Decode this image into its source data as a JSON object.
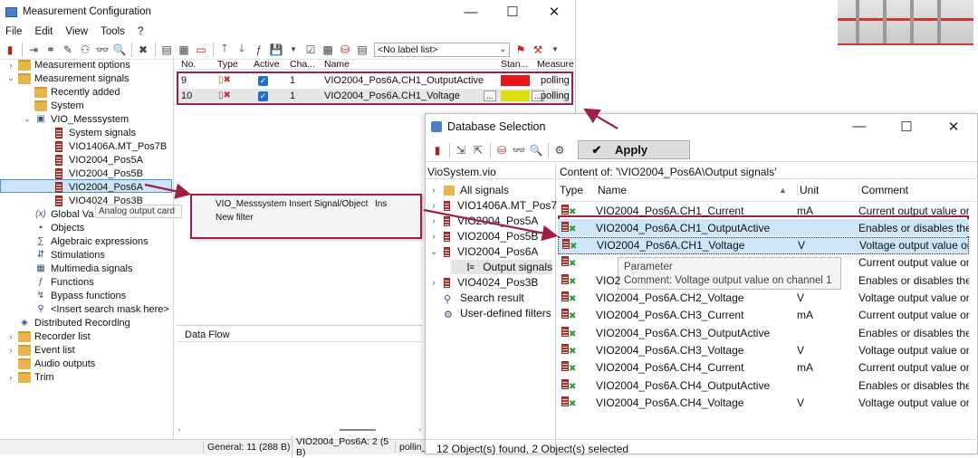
{
  "main": {
    "title": "Measurement Configuration",
    "menu": [
      "File",
      "Edit",
      "View",
      "Tools",
      "?"
    ],
    "label_list": "<No label list>",
    "tree": [
      {
        "label": "Measurement options",
        "icon": "folder-icon",
        "toggle": "›"
      },
      {
        "label": "Measurement signals",
        "icon": "folder-icon",
        "toggle": "⌄"
      },
      {
        "label": "Recently added",
        "icon": "folder-icon",
        "toggle": ""
      },
      {
        "label": "System",
        "icon": "folder-icon",
        "toggle": ""
      },
      {
        "label": "VIO_Messsystem",
        "icon": "device-icon",
        "toggle": "⌄"
      },
      {
        "label": "System signals",
        "icon": "signal-icon",
        "toggle": ""
      },
      {
        "label": "VIO1406A.MT_Pos7B",
        "icon": "signal-icon",
        "toggle": ""
      },
      {
        "label": "VIO2004_Pos5A",
        "icon": "signal-icon",
        "toggle": ""
      },
      {
        "label": "VIO2004_Pos5B",
        "icon": "signal-icon",
        "toggle": ""
      },
      {
        "label": "VIO2004_Pos6A",
        "icon": "signal-icon",
        "toggle": ""
      },
      {
        "label": "VIO4024_Pos3B",
        "icon": "signal-icon",
        "toggle": ""
      },
      {
        "label": "Global Va",
        "icon": "variable-icon",
        "toggle": ""
      },
      {
        "label": "Objects",
        "icon": "objects-icon",
        "toggle": ""
      },
      {
        "label": "Algebraic expressions",
        "icon": "expression-icon",
        "toggle": ""
      },
      {
        "label": "Stimulations",
        "icon": "stimulation-icon",
        "toggle": ""
      },
      {
        "label": "Multimedia signals",
        "icon": "multimedia-icon",
        "toggle": ""
      },
      {
        "label": "Functions",
        "icon": "function-icon",
        "toggle": ""
      },
      {
        "label": "Bypass functions",
        "icon": "bypass-icon",
        "toggle": ""
      },
      {
        "label": "<Insert search mask here>",
        "icon": "search-icon",
        "toggle": ""
      },
      {
        "label": "Distributed Recording",
        "icon": "recording-icon",
        "toggle": ""
      },
      {
        "label": "Recorder list",
        "icon": "folder-icon",
        "toggle": "›"
      },
      {
        "label": "Event list",
        "icon": "folder-icon",
        "toggle": "›"
      },
      {
        "label": "Audio outputs",
        "icon": "folder-icon",
        "toggle": ""
      },
      {
        "label": "Trim",
        "icon": "folder-icon",
        "toggle": "›"
      }
    ],
    "tooltip": "Analog output card",
    "columns": [
      "No.",
      "Type",
      "Active",
      "Cha...",
      "Name",
      "Stan...",
      "Measure"
    ],
    "rows": [
      {
        "no": "9",
        "channel": "1",
        "name": "VIO2004_Pos6A.CH1_OutputActive",
        "standard_color": "#e81616",
        "measure": "polling"
      },
      {
        "no": "10",
        "channel": "1",
        "name": "VIO2004_Pos6A.CH1_Voltage",
        "standard_color": "#dede10",
        "measure": "polling"
      }
    ],
    "ellipsis": "...",
    "context_menu": [
      {
        "label": "VIO_Messsystem Insert Signal/Object",
        "shortcut": "Ins"
      },
      {
        "label": "New filter",
        "shortcut": ""
      }
    ],
    "data_flow_title": "Data Flow",
    "status": {
      "general": "General:  11 (288 B)",
      "device": "VIO2004_Pos6A: 2 (5 B)",
      "mode": "pollin_"
    }
  },
  "db": {
    "title": "Database Selection",
    "apply": "Apply",
    "root": "VioSystem.vio",
    "content_of": "Content of: '\\VIO2004_Pos6A\\Output signals'",
    "tree": [
      {
        "label": "VioSystem.vio",
        "toggle": "",
        "indent": 0
      },
      {
        "label": "All signals",
        "toggle": "›",
        "indent": 1
      },
      {
        "label": "VIO1406A.MT_Pos7",
        "toggle": "›",
        "indent": 1
      },
      {
        "label": "VIO2004_Pos5A",
        "toggle": "›",
        "indent": 1
      },
      {
        "label": "VIO2004_Pos5B",
        "toggle": "›",
        "indent": 1
      },
      {
        "label": "VIO2004_Pos6A",
        "toggle": "⌄",
        "indent": 1
      },
      {
        "label": "Output signals",
        "toggle": "",
        "indent": 2
      },
      {
        "label": "VIO4024_Pos3B",
        "toggle": "›",
        "indent": 1
      },
      {
        "label": "Search result",
        "toggle": "",
        "indent": 0
      },
      {
        "label": "User-defined filters",
        "toggle": "",
        "indent": 0
      }
    ],
    "columns": [
      "Type",
      "Name",
      "Unit",
      "Comment"
    ],
    "rows": [
      {
        "name": "VIO2004_Pos6A.CH1_Current",
        "unit": "mA",
        "comment": "Current output value on"
      },
      {
        "name": "VIO2004_Pos6A.CH1_OutputActive",
        "unit": "",
        "comment": "Enables or disables the v"
      },
      {
        "name": "VIO2004_Pos6A.CH1_Voltage",
        "unit": "V",
        "comment": "Voltage output value on"
      },
      {
        "name": "",
        "unit": "",
        "comment": "Current output value on"
      },
      {
        "name": "VIO2",
        "unit": "",
        "comment": "Enables or disables the v"
      },
      {
        "name": "VIO2004_Pos6A.CH2_Voltage",
        "unit": "V",
        "comment": "Voltage output value on"
      },
      {
        "name": "VIO2004_Pos6A.CH3_Current",
        "unit": "mA",
        "comment": "Current output value on"
      },
      {
        "name": "VIO2004_Pos6A.CH3_OutputActive",
        "unit": "",
        "comment": "Enables or disables the v"
      },
      {
        "name": "VIO2004_Pos6A.CH3_Voltage",
        "unit": "V",
        "comment": "Voltage output value on"
      },
      {
        "name": "VIO2004_Pos6A.CH4_Current",
        "unit": "mA",
        "comment": "Current output value on"
      },
      {
        "name": "VIO2004_Pos6A.CH4_OutputActive",
        "unit": "",
        "comment": "Enables or disables the v"
      },
      {
        "name": "VIO2004_Pos6A.CH4_Voltage",
        "unit": "V",
        "comment": "Voltage output value on"
      }
    ],
    "tooltip_title": "Parameter",
    "tooltip_comment": "Comment: Voltage output value on channel 1",
    "status": "12 Object(s) found,   2 Object(s) selected"
  }
}
